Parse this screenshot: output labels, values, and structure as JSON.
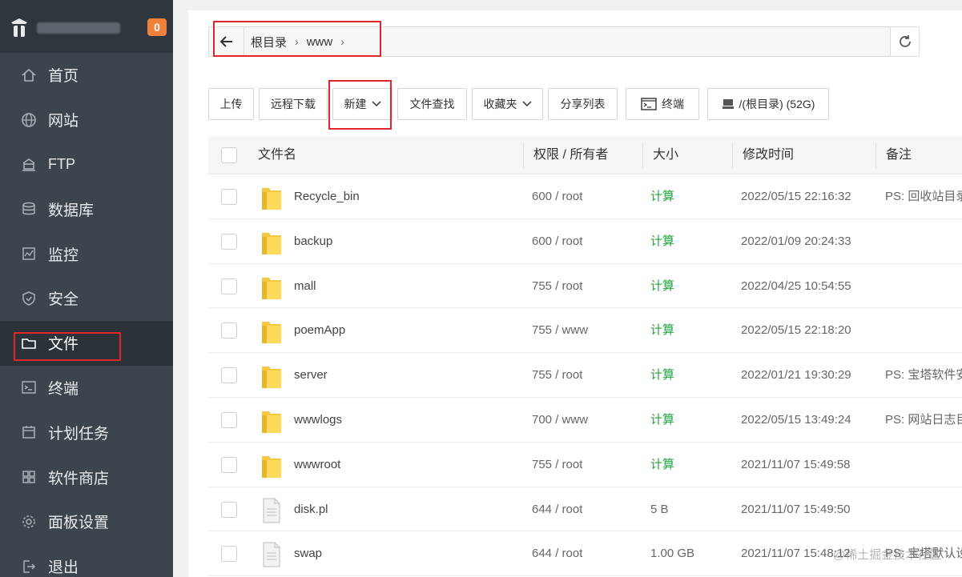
{
  "sidebar": {
    "badge": "0",
    "items": [
      {
        "label": "首页",
        "icon": "home-icon"
      },
      {
        "label": "网站",
        "icon": "globe-icon"
      },
      {
        "label": "FTP",
        "icon": "ftp-icon"
      },
      {
        "label": "数据库",
        "icon": "database-icon"
      },
      {
        "label": "监控",
        "icon": "monitor-icon"
      },
      {
        "label": "安全",
        "icon": "shield-icon"
      },
      {
        "label": "文件",
        "icon": "folder-icon",
        "active": true
      },
      {
        "label": "终端",
        "icon": "terminal-icon"
      },
      {
        "label": "计划任务",
        "icon": "calendar-icon"
      },
      {
        "label": "软件商店",
        "icon": "apps-icon"
      },
      {
        "label": "面板设置",
        "icon": "gear-icon"
      },
      {
        "label": "退出",
        "icon": "logout-icon"
      }
    ]
  },
  "path": {
    "crumbs": [
      "根目录",
      "www"
    ]
  },
  "toolbar": {
    "upload": "上传",
    "remote_download": "远程下载",
    "new": "新建",
    "search": "文件查找",
    "favorites": "收藏夹",
    "share_list": "分享列表",
    "terminal": "终端",
    "disk": "/(根目录) (52G)"
  },
  "table": {
    "headers": {
      "name": "文件名",
      "perm": "权限 / 所有者",
      "size": "大小",
      "mtime": "修改时间",
      "note": "备注"
    },
    "rows": [
      {
        "name": "Recycle_bin",
        "type": "folder",
        "perm": "600 / root",
        "size": "计算",
        "mtime": "2022/05/15 22:16:32",
        "note": "PS: 回收站目录"
      },
      {
        "name": "backup",
        "type": "folder",
        "perm": "600 / root",
        "size": "计算",
        "mtime": "2022/01/09 20:24:33",
        "note": ""
      },
      {
        "name": "mall",
        "type": "folder",
        "perm": "755 / root",
        "size": "计算",
        "mtime": "2022/04/25 10:54:55",
        "note": ""
      },
      {
        "name": "poemApp",
        "type": "folder",
        "perm": "755 / www",
        "size": "计算",
        "mtime": "2022/05/15 22:18:20",
        "note": ""
      },
      {
        "name": "server",
        "type": "folder",
        "perm": "755 / root",
        "size": "计算",
        "mtime": "2022/01/21 19:30:29",
        "note": "PS: 宝塔软件安"
      },
      {
        "name": "wwwlogs",
        "type": "folder",
        "perm": "700 / www",
        "size": "计算",
        "mtime": "2022/05/15 13:49:24",
        "note": "PS: 网站日志目"
      },
      {
        "name": "wwwroot",
        "type": "folder",
        "perm": "755 / root",
        "size": "计算",
        "mtime": "2021/11/07 15:49:58",
        "note": ""
      },
      {
        "name": "disk.pl",
        "type": "file",
        "perm": "644 / root",
        "size": "5 B",
        "mtime": "2021/11/07 15:49:50",
        "note": ""
      },
      {
        "name": "swap",
        "type": "file",
        "perm": "644 / root",
        "size": "1.00 GB",
        "mtime": "2021/11/07 15:48:12",
        "note": "PS: 宝塔默认设"
      }
    ]
  },
  "watermark": "@稀土掘金技术社区",
  "colors": {
    "sidebar_bg": "#3c444d",
    "accent_green": "#20a53a",
    "badge_orange": "#f0813a",
    "highlight_red": "#e0262b"
  }
}
